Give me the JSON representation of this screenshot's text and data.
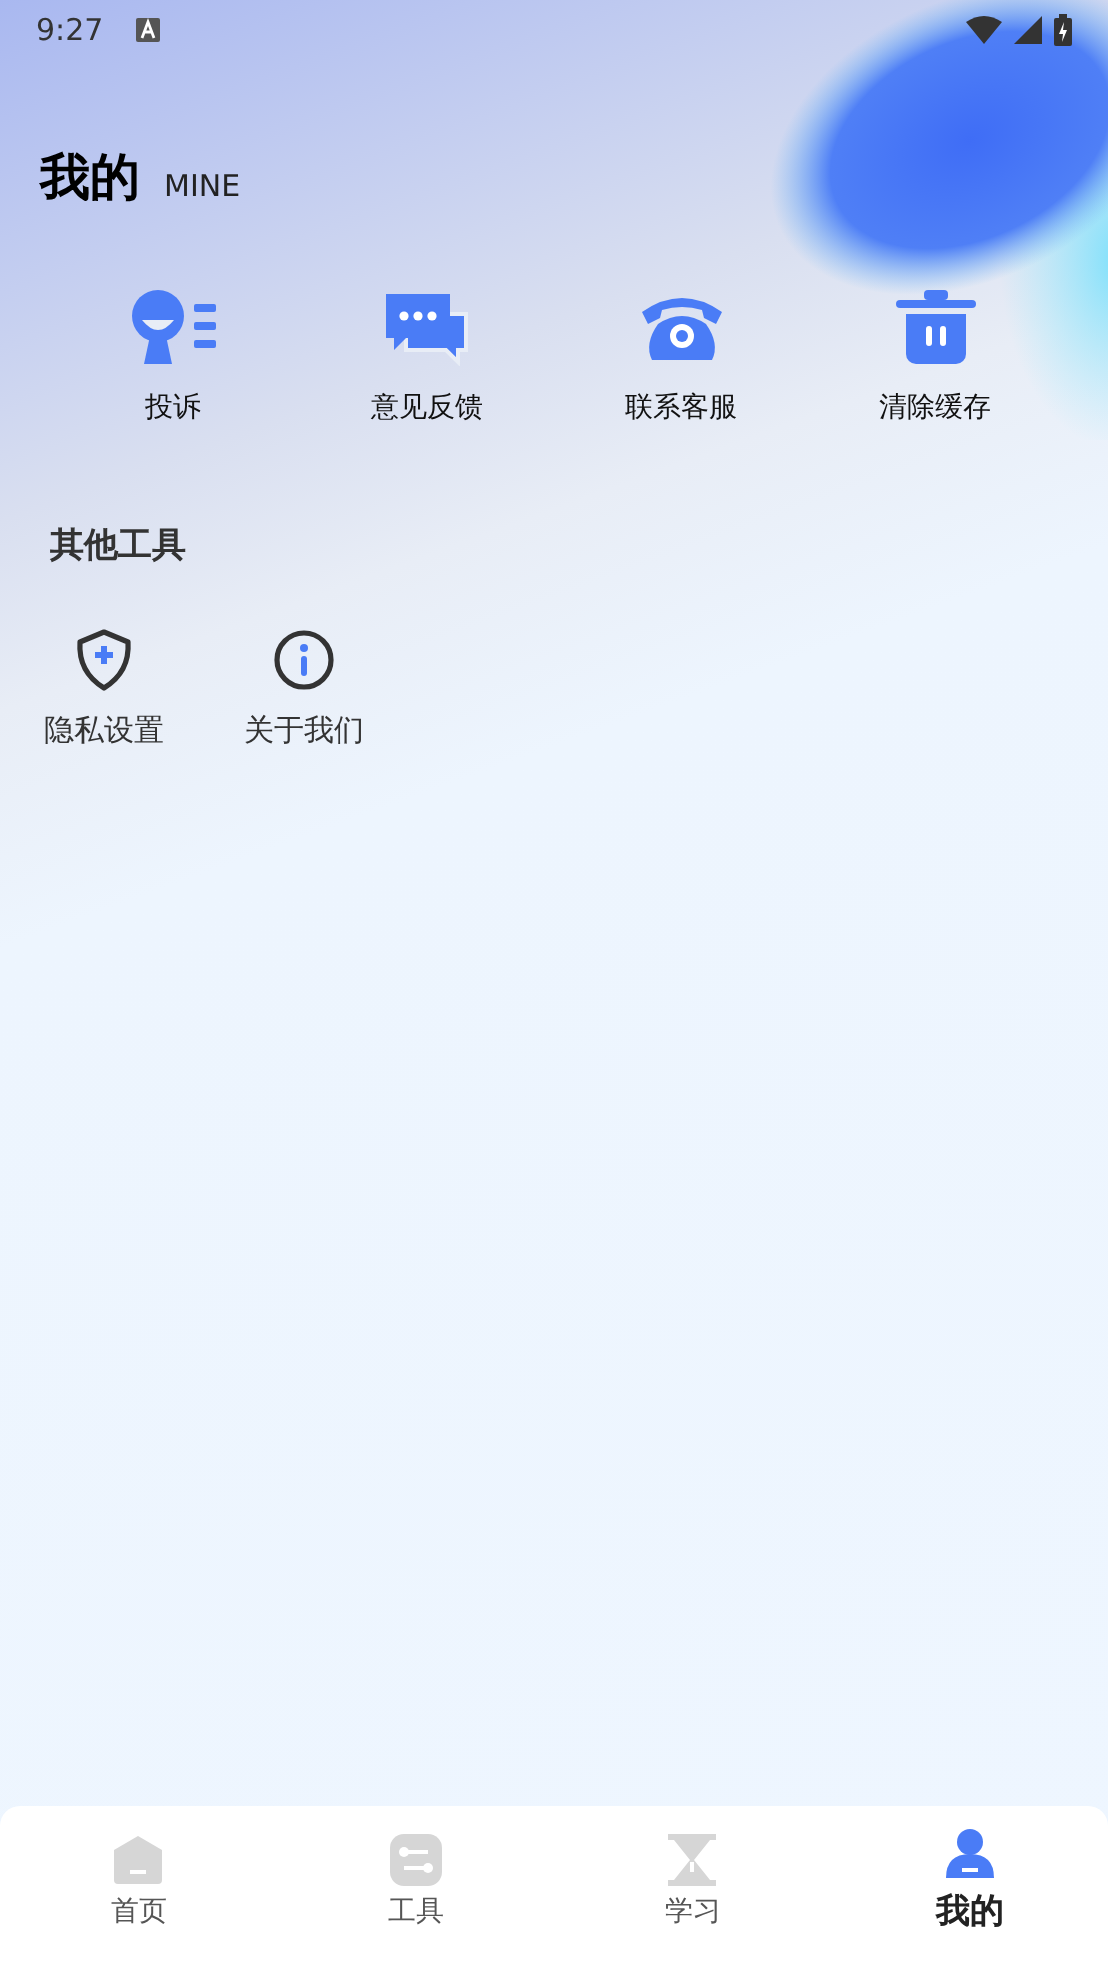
{
  "status_bar": {
    "time": "9:27"
  },
  "header": {
    "title": "我的",
    "subtitle": "MINE"
  },
  "quick_actions": [
    {
      "kind": "complaint",
      "label": "投诉"
    },
    {
      "kind": "feedback",
      "label": "意见反馈"
    },
    {
      "kind": "phone",
      "label": "联系客服"
    },
    {
      "kind": "trash",
      "label": "清除缓存"
    }
  ],
  "other_tools": {
    "title": "其他工具",
    "items": [
      {
        "kind": "shield",
        "label": "隐私设置"
      },
      {
        "kind": "info",
        "label": "关于我们"
      }
    ]
  },
  "tab_bar": [
    {
      "kind": "home",
      "label": "首页",
      "selected": false
    },
    {
      "kind": "tools",
      "label": "工具",
      "selected": false
    },
    {
      "kind": "study",
      "label": "学习",
      "selected": false
    },
    {
      "kind": "me",
      "label": "我的",
      "selected": true
    }
  ]
}
